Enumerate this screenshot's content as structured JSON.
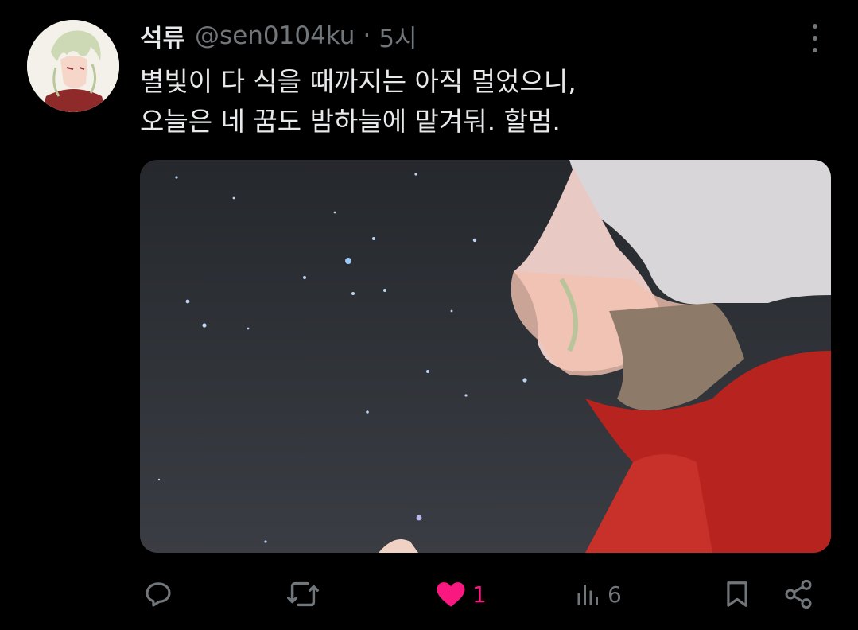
{
  "tweet": {
    "author_name": "석류",
    "handle": "@sen0104ku",
    "separator": "·",
    "time": "5시",
    "text_lines": [
      "별빛이 다 식을 때까지는 아직 멀었으니,",
      "오늘은 네 꿈도 밤하늘에 맡겨둬. 할멈."
    ],
    "avatar_icon": "avatar-image",
    "more_icon": "more-vertical-icon",
    "media_description_icon": "attached-image"
  },
  "actions": {
    "reply": {
      "icon": "reply-icon",
      "count": ""
    },
    "retweet": {
      "icon": "retweet-icon",
      "count": ""
    },
    "like": {
      "icon": "heart-filled-icon",
      "count": "1",
      "liked": true
    },
    "views": {
      "icon": "views-icon",
      "count": "6"
    },
    "bookmark": {
      "icon": "bookmark-icon"
    },
    "share": {
      "icon": "share-icon"
    }
  },
  "colors": {
    "background": "#000000",
    "text_primary": "#e7e9ea",
    "text_secondary": "#71767b",
    "like_pink": "#f91880"
  }
}
